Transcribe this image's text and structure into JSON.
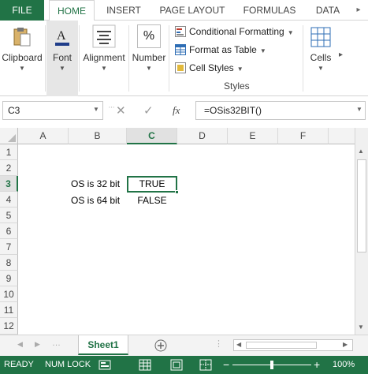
{
  "tabs": {
    "file": "FILE",
    "home": "HOME",
    "insert": "INSERT",
    "page_layout": "PAGE LAYOUT",
    "formulas": "FORMULAS",
    "data": "DATA"
  },
  "ribbon": {
    "clipboard": "Clipboard",
    "font": "Font",
    "alignment": "Alignment",
    "number": "Number",
    "number_icon": "%",
    "conditional_formatting": "Conditional Formatting",
    "format_as_table": "Format as Table",
    "cell_styles": "Cell Styles",
    "styles_group": "Styles",
    "cells": "Cells"
  },
  "formula_bar": {
    "name_box": "C3",
    "fx": "fx",
    "formula": "=OSis32BIT()"
  },
  "grid": {
    "columns": [
      "A",
      "B",
      "C",
      "D",
      "E",
      "F"
    ],
    "rows": [
      "1",
      "2",
      "3",
      "4",
      "5",
      "6",
      "7",
      "8",
      "9",
      "10",
      "11",
      "12"
    ],
    "cells": {
      "b3": "OS is 32 bit",
      "c3": "TRUE",
      "b4": "OS is 64 bit",
      "c4": "FALSE"
    },
    "active_cell": "C3"
  },
  "sheets": {
    "sheet1": "Sheet1"
  },
  "status_bar": {
    "ready": "READY",
    "num_lock": "NUM LOCK",
    "zoom": "100%"
  },
  "colors": {
    "accent": "#217346",
    "header_bg": "#f3f3f3"
  }
}
